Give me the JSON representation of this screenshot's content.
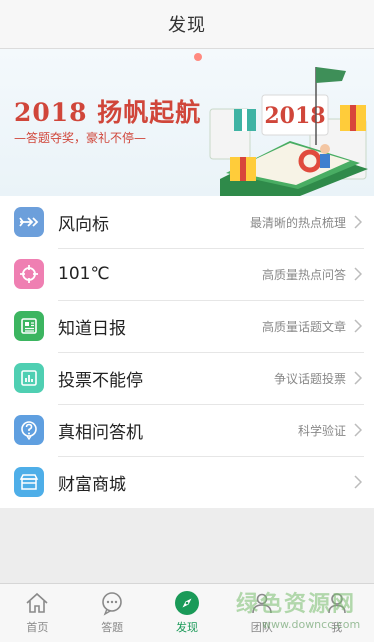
{
  "header": {
    "title": "发现"
  },
  "banner": {
    "headline": "2018 扬帆起航",
    "tagline": "—答题夺奖，豪礼不停—",
    "sign_text": "2018"
  },
  "menu": [
    {
      "icon": "wind-vane-icon",
      "label": "风向标",
      "desc": "最清晰的热点梳理",
      "color": "#6c9fdb"
    },
    {
      "icon": "target-icon",
      "label": "101℃",
      "desc": "高质量热点问答",
      "color": "#ef7fb2"
    },
    {
      "icon": "newspaper-icon",
      "label": "知道日报",
      "desc": "高质量话题文章",
      "color": "#3cb560"
    },
    {
      "icon": "bar-chart-icon",
      "label": "投票不能停",
      "desc": "争议话题投票",
      "color": "#4fcfb2"
    },
    {
      "icon": "question-bubble-icon",
      "label": "真相问答机",
      "desc": "科学验证",
      "color": "#5f9fe0"
    },
    {
      "icon": "store-icon",
      "label": "财富商城",
      "desc": "",
      "color": "#4eaee8"
    }
  ],
  "nav": {
    "tabs": [
      {
        "icon": "home-icon",
        "label": "首页",
        "active": false
      },
      {
        "icon": "chat-bubble-icon",
        "label": "答题",
        "active": false
      },
      {
        "icon": "compass-icon",
        "label": "发现",
        "active": true
      },
      {
        "icon": "team-icon",
        "label": "团队",
        "active": false
      },
      {
        "icon": "user-icon",
        "label": "我",
        "active": false
      }
    ]
  },
  "watermark": {
    "text": "绿色资源网",
    "url": "www.downcc.com"
  },
  "colors": {
    "accent": "#1a9a58",
    "banner_red": "#d0463a"
  }
}
